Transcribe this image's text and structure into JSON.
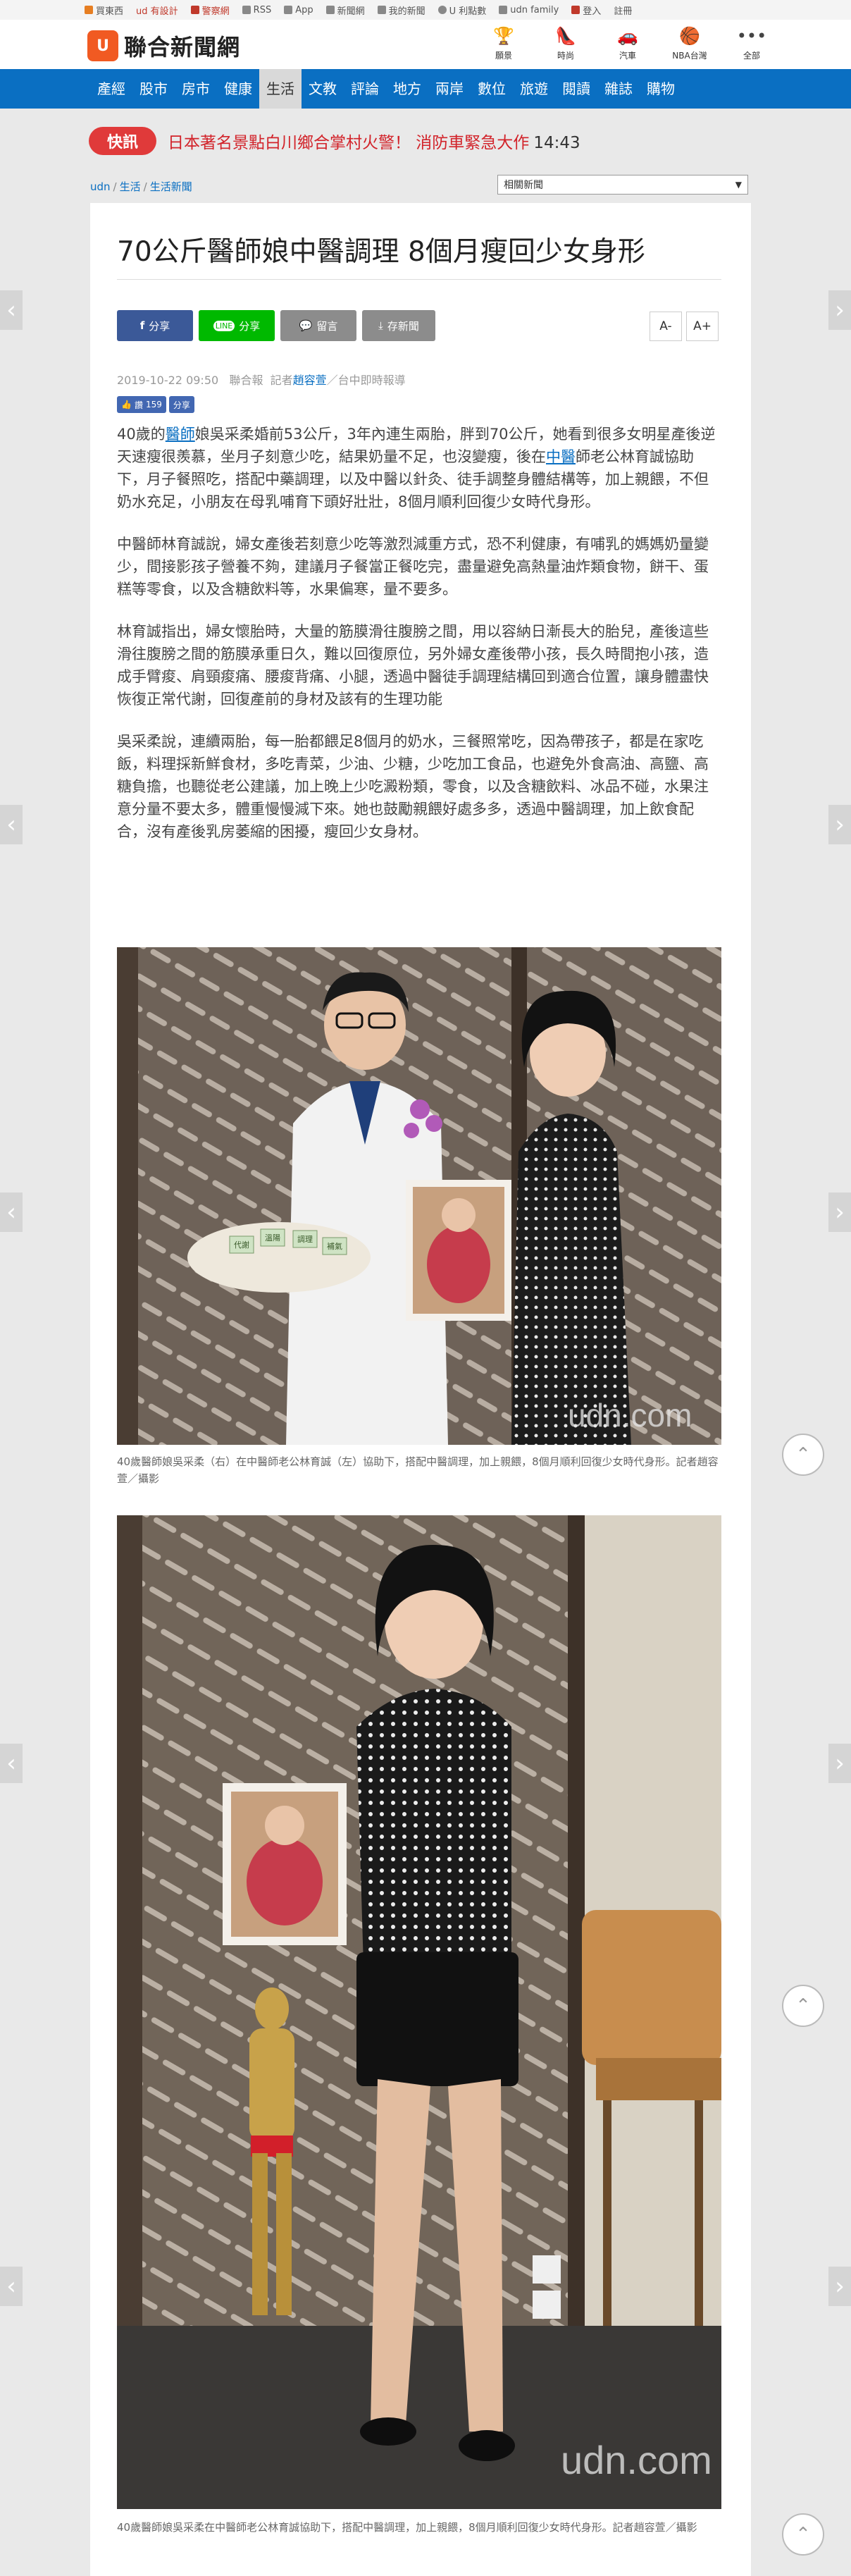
{
  "util_bar": {
    "items": [
      "買東西",
      "ud 有設計",
      "警察網",
      "RSS",
      "App",
      "新聞網",
      "我的新聞",
      "U 利點數",
      "udn family",
      "登入",
      "註冊"
    ]
  },
  "header": {
    "logo_mark": "U",
    "site_name": "聯合新聞網",
    "quick": [
      {
        "icon": "trophy-icon",
        "label": "願景",
        "glyph": "🏆"
      },
      {
        "icon": "heel-icon",
        "label": "時尚",
        "glyph": "👠"
      },
      {
        "icon": "car-icon",
        "label": "汽車",
        "glyph": "🚗"
      },
      {
        "icon": "basketball-icon",
        "label": "NBA台灣",
        "glyph": "🏀"
      },
      {
        "icon": "more-icon",
        "label": "全部",
        "glyph": "•••"
      }
    ]
  },
  "nav": {
    "items": [
      "產經",
      "股市",
      "房市",
      "健康",
      "生活",
      "文教",
      "評論",
      "地方",
      "兩岸",
      "數位",
      "旅遊",
      "閱讀",
      "雜誌",
      "購物"
    ],
    "active_index": 4
  },
  "breaking": {
    "badge": "快訊",
    "text": "日本著名景點白川鄉合掌村火警！ 消防車緊急大作",
    "time": "14:43"
  },
  "breadcrumb": [
    "udn",
    "生活",
    "生活新聞"
  ],
  "related_select": "相關新聞",
  "article": {
    "title": "70公斤醫師娘中醫調理 8個月瘦回少女身形",
    "share": {
      "facebook": "分享",
      "line": "分享",
      "comment": "留言",
      "save": "存新聞"
    },
    "font_small": "A-",
    "font_large": "A+",
    "date": "2019-10-22 09:50",
    "source": "聯合報",
    "reporter_prefix": "記者",
    "reporter": "趙容萱",
    "location": "／台中即時報導",
    "like_label": "讚",
    "like_count": "159",
    "share_label": "分享",
    "p1_a": "40歲的",
    "p1_link1": "醫師",
    "p1_b": "娘吳采柔婚前53公斤，3年內連生兩胎，胖到70公斤，她看到很多女明星產後逆天速瘦很羨慕，坐月子刻意少吃，結果奶量不足，也沒變瘦，後在",
    "p1_link2": "中醫",
    "p1_c": "師老公林育誠協助下，月子餐照吃，搭配中藥調理，以及中醫以針灸、徒手調整身體結構等，加上親餵，不但奶水充足，小朋友在母乳哺育下頭好壯壯，8個月順利回復少女時代身形。",
    "p2": "中醫師林育誠說，婦女產後若刻意少吃等激烈減重方式，恐不利健康，有哺乳的媽媽奶量變少，間接影孩子營養不夠，建議月子餐當正餐吃完，盡量避免高熱量油炸類食物，餅干、蛋糕等零食，以及含糖飲料等，水果偏寒，量不要多。",
    "p3": "林育誠指出，婦女懷胎時，大量的筋膜滑往腹膀之間，用以容納日漸長大的胎兒，產後這些滑往腹膀之間的筋膜承重日久，難以回復原位，另外婦女產後帶小孩，長久時間抱小孩，造成手臂痠、肩頸痠痛、腰痠背痛、小腿，透過中醫徒手調理結構回到適合位置，讓身體盡快恢復正常代謝，回復產前的身材及該有的生理功能",
    "p4": "吳采柔說，連續兩胎，每一胎都餵足8個月的奶水，三餐照常吃，因為帶孩子，都是在家吃飯，料理採新鮮食材，多吃青菜，少油、少糖，少吃加工食品，也避免外食高油、高鹽、高糖負擔，也聽從老公建議，加上晚上少吃澱粉類，零食，以及含糖飲料、冰品不碰，水果注意分量不要太多，體重慢慢減下來。她也鼓勵親餵好處多多，透過中醫調理，加上飲食配合，沒有產後乳房萎縮的困擾，瘦回少女身材。",
    "photo_watermark": "udn.com",
    "photo1_card": [
      "代謝",
      "溫陽",
      "調理",
      "補氣"
    ],
    "caption1": "40歲醫師娘吳采柔（右）在中醫師老公林育誠（左）協助下，搭配中醫調理，加上親餵，8個月順利回復少女時代身形。記者趙容萱／攝影",
    "caption2": "40歲醫師娘吳采柔在中醫師老公林育誠協助下，搭配中醫調理，加上親餵，8個月順利回復少女時代身形。記者趙容萱／攝影"
  },
  "controls": {
    "prev": "‹",
    "next": "›",
    "to_top": "⌃"
  }
}
